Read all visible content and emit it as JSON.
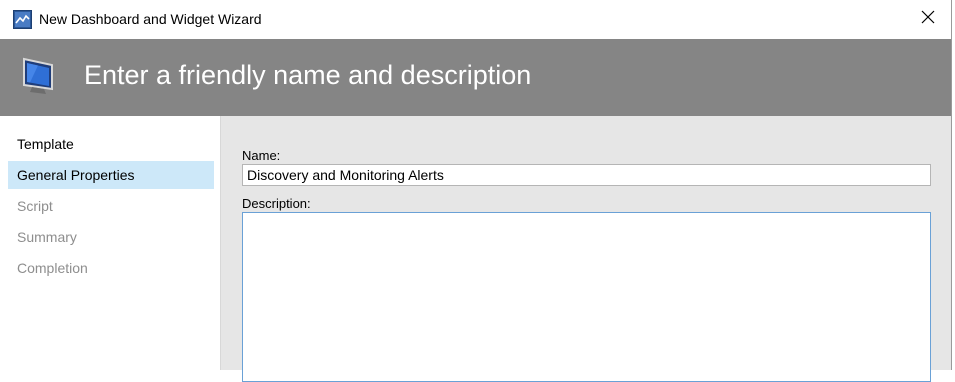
{
  "window": {
    "title": "New Dashboard and Widget Wizard",
    "close_icon": "close-icon"
  },
  "header": {
    "title": "Enter a friendly name and description",
    "icon": "monitor-icon"
  },
  "nav": {
    "items": [
      {
        "label": "Template",
        "state": "done"
      },
      {
        "label": "General Properties",
        "state": "current"
      },
      {
        "label": "Script",
        "state": "pending"
      },
      {
        "label": "Summary",
        "state": "pending"
      },
      {
        "label": "Completion",
        "state": "pending"
      }
    ]
  },
  "form": {
    "name_label": "Name:",
    "name_value": "Discovery and Monitoring Alerts",
    "description_label": "Description:",
    "description_value": ""
  },
  "colors": {
    "header_bg": "#858585",
    "nav_selected_bg": "#cde8f9",
    "content_bg": "#e6e6e6",
    "focus_border": "#6aa1d6"
  }
}
